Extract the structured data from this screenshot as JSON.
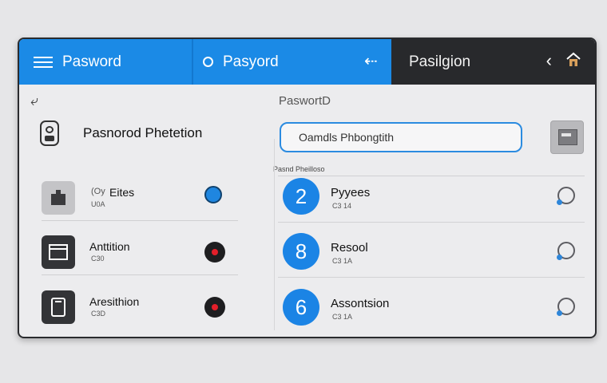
{
  "topbar": {
    "title1": "Pasword",
    "title2": "Pasyord",
    "title3": "Pasilgion"
  },
  "content": {
    "center_label": "PaswortD",
    "left_header": "Pasnorod Phetetion",
    "search": {
      "value": "Oamdls Phbongtith"
    },
    "section_label": "Pasnd Pheilloso"
  },
  "left_items": [
    {
      "title": "Eites",
      "prefix": "(Oy",
      "sub": "U0A"
    },
    {
      "title": "Anttition",
      "sub": "C30"
    },
    {
      "title": "Aresithion",
      "sub": "C3D"
    }
  ],
  "right_items": [
    {
      "number": "2",
      "title": "Pyyees",
      "sub": "C3 14"
    },
    {
      "number": "8",
      "title": "Resool",
      "sub": "C3 1A"
    },
    {
      "number": "6",
      "title": "Assontsion",
      "sub": "C3 1A"
    }
  ],
  "icons": {
    "menu": "menu-icon",
    "ring": "ring-icon",
    "back": "back-arrow-icon",
    "chevron": "chevron-left-icon",
    "home": "home-icon",
    "lock": "lock-icon"
  },
  "colors": {
    "accent": "#1b8ae6",
    "dark_bar": "#28292c",
    "record_red": "#e41f2a"
  }
}
